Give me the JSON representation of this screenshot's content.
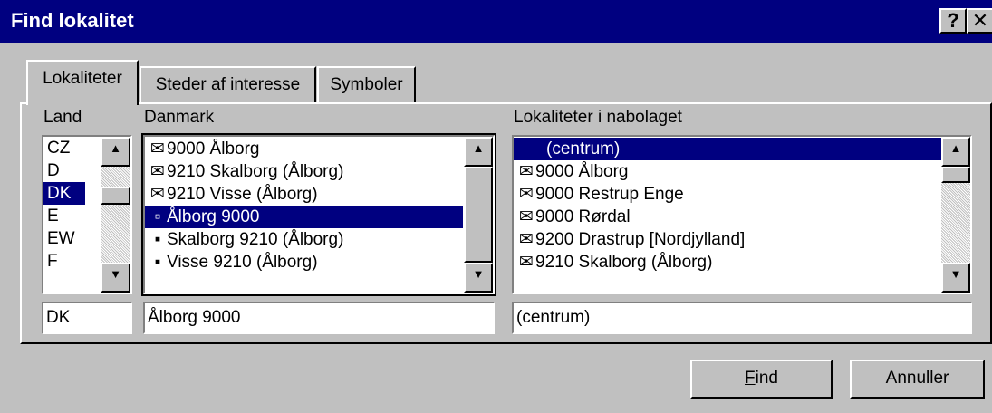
{
  "window": {
    "title": "Find lokalitet",
    "help_glyph": "?",
    "close_glyph": "✕"
  },
  "tabs": [
    {
      "label": "Lokaliteter",
      "active": true
    },
    {
      "label": "Steder af interesse",
      "active": false
    },
    {
      "label": "Symboler",
      "active": false
    }
  ],
  "land": {
    "label": "Land",
    "items": [
      "CZ",
      "D",
      "DK",
      "E",
      "EW",
      "F"
    ],
    "selected": "DK",
    "field_value": "DK"
  },
  "danmark": {
    "label": "Danmark",
    "items": [
      {
        "icon": "envelope-icon",
        "glyph": "✉",
        "text": "9000 Ålborg"
      },
      {
        "icon": "envelope-icon",
        "glyph": "✉",
        "text": "9210 Skalborg (Ålborg)"
      },
      {
        "icon": "envelope-icon",
        "glyph": "✉",
        "text": "9210 Visse (Ålborg)"
      },
      {
        "icon": "locality-square-icon",
        "glyph": "▫",
        "text": "Ålborg 9000"
      },
      {
        "icon": "locality-dot-icon",
        "glyph": "▪",
        "text": "Skalborg 9210 (Ålborg)"
      },
      {
        "icon": "locality-dot-icon",
        "glyph": "▪",
        "text": "Visse 9210 (Ålborg)"
      }
    ],
    "selected_index": 3,
    "field_value": "Ålborg 9000"
  },
  "nabolag": {
    "label": "Lokaliteter i nabolaget",
    "items": [
      {
        "icon": "",
        "glyph": "",
        "text": "(centrum)"
      },
      {
        "icon": "envelope-icon",
        "glyph": "✉",
        "text": "9000 Ålborg"
      },
      {
        "icon": "envelope-icon",
        "glyph": "✉",
        "text": "9000 Restrup Enge"
      },
      {
        "icon": "envelope-icon",
        "glyph": "✉",
        "text": "9000 Rørdal"
      },
      {
        "icon": "envelope-icon",
        "glyph": "✉",
        "text": "9200 Drastrup [Nordjylland]"
      },
      {
        "icon": "envelope-icon",
        "glyph": "✉",
        "text": "9210 Skalborg (Ålborg)"
      }
    ],
    "selected_index": 0,
    "field_value": "(centrum)"
  },
  "buttons": {
    "find_mnemonic": "F",
    "find_rest": "ind",
    "cancel": "Annuller"
  },
  "scroll": {
    "up_glyph": "▲",
    "down_glyph": "▼"
  }
}
